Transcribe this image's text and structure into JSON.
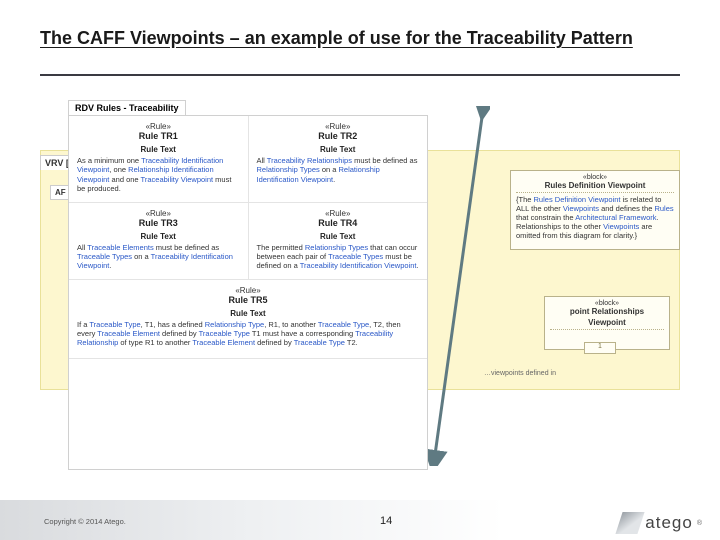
{
  "title": "The CAFF Viewpoints – an example of use for the Traceability Pattern",
  "tabs": {
    "rdv": "RDV Rules - Traceability",
    "vrv": "VRV [",
    "af": "AF"
  },
  "stereo": {
    "rule": "«Rule»",
    "block": "«block»"
  },
  "labels": {
    "ruleText": "Rule Text"
  },
  "rules": {
    "tr1": {
      "name": "Rule TR1",
      "pre": "As a minimum one ",
      "kw1": "Traceability Identification Viewpoint",
      "mid1": ", one ",
      "kw2": "Relationship Identification Viewpoint",
      "mid2": " and one ",
      "kw3": "Traceability Viewpoint",
      "post": " must be produced."
    },
    "tr2": {
      "name": "Rule TR2",
      "pre": "All ",
      "kw1": "Traceability Relationships",
      "mid1": " must be defined as ",
      "kw2": "Relationship Types",
      "mid2": " on a ",
      "kw3": "Relationship Identification Viewpoint",
      "post": "."
    },
    "tr3": {
      "name": "Rule TR3",
      "pre": "All ",
      "kw1": "Traceable Elements",
      "mid1": " must be defined as ",
      "kw2": "Traceable Types",
      "mid2": " on a ",
      "kw3": "Traceability Identification Viewpoint",
      "post": "."
    },
    "tr4": {
      "name": "Rule TR4",
      "pre": "The permitted ",
      "kw1": "Relationship Types",
      "mid1": " that can occur between each pair of ",
      "kw2": "Traceable Types",
      "mid2": " must be defined on a ",
      "kw3": "Traceability Identification Viewpoint",
      "post": "."
    },
    "tr5": {
      "name": "Rule TR5",
      "p1a": "If a ",
      "p1k1": "Traceable Type",
      "p1b": ", T1, has a defined ",
      "p1k2": "Relationship Type",
      "p1c": ", R1, to another ",
      "p1k3": "Traceable Type",
      "p1d": ", T2, then every ",
      "p1k4": "Traceable Element",
      "p1e": " defined by ",
      "p1k5": "Traceable Type",
      "p2a": " T1 must have a corresponding ",
      "p2k1": "Traceability Relationship",
      "p2b": " of type R1 to another ",
      "p2k2": "Traceable Element",
      "p2c": " defined by ",
      "p2k3": "Traceable Type",
      "p2d": " T2."
    }
  },
  "blocks": {
    "rdv": {
      "name": "Rules Definition Viewpoint",
      "note1": "{The ",
      "kw1": "Rules Definition Viewpoint",
      "note2": " is related to ALL the other ",
      "kw2": "Viewpoints",
      "note3": " and defines the ",
      "kw3": "Rules",
      "note4": " that constrain the ",
      "kw4": "Architectural Framework",
      "note5": ". Relationships to the other ",
      "kw5": "Viewpoints",
      "note6": " are omitted from this diagram for clarity.}"
    },
    "rel": {
      "name1": "point Relationships",
      "name2": "Viewpoint",
      "one": "1"
    }
  },
  "fragment": "…viewpoints defined in",
  "footer": {
    "copyright": "Copyright © 2014 Atego.",
    "page": "14",
    "brand": "atego",
    "reg": "®"
  }
}
